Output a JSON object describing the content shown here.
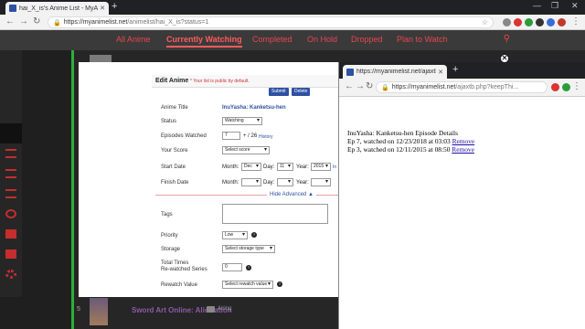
{
  "browser": {
    "tab_title": "hai_X_is's Anime List - MyAnim",
    "url_host": "https://myanimelist.net",
    "url_path": "/animelist/hai_X_is?status=1"
  },
  "mal": {
    "nav": [
      "All Anime",
      "Currently Watching",
      "Completed",
      "On Hold",
      "Dropped",
      "Plan to Watch"
    ],
    "active_tab": "Currently Watching",
    "bottom_row": {
      "num": "5",
      "title": "Sword Art Online: Alicization",
      "status": "Airing"
    }
  },
  "edit": {
    "header": "Edit Anime",
    "note": "* Your list is public by default.",
    "submit": "Submit",
    "delete": "Delete",
    "labels": {
      "anime_title": "Anime Title",
      "status": "Status",
      "episodes": "Episodes Watched",
      "score": "Your Score",
      "start": "Start Date",
      "finish": "Finish Date",
      "tags": "Tags",
      "priority": "Priority",
      "storage": "Storage",
      "total_times": "Total Times",
      "rewatched": "Re-watched Series",
      "rewatch_value": "Rewatch Value"
    },
    "values": {
      "anime_title": "InuYasha: Kanketsu-hen",
      "status": "Watching",
      "episodes": "7",
      "episodes_total": "+ / 26",
      "history": "History",
      "score": "Select score",
      "month_lbl": "Month:",
      "day_lbl": "Day:",
      "year_lbl": "Year:",
      "start_month": "Dec",
      "start_day": "11",
      "start_year": "2015",
      "start_suffix": "In",
      "hide_advanced": "Hide Advanced ▲",
      "priority": "Low",
      "storage": "Select storage type",
      "total_times": "0",
      "rewatch_value": "Select rewatch value"
    }
  },
  "popup_window": {
    "tab_title": "https://myanimelist.net/ajaxtb.p",
    "url_host": "https://myanimelist.net",
    "url_path": "/ajaxtb.php?keepThi...",
    "heading": "InuYasha: Kanketsu-hen Episode Details",
    "lines": [
      {
        "text": "Ep 7, watched on 12/23/2018 at 03:03",
        "link": "Remove"
      },
      {
        "text": "Ep 3, watched on 12/11/2015 at 08:50",
        "link": "Remove"
      }
    ]
  },
  "colors": {
    "mal_red": "#e5474e",
    "mal_blue": "#2e51a2",
    "green_bar": "#2db039"
  }
}
